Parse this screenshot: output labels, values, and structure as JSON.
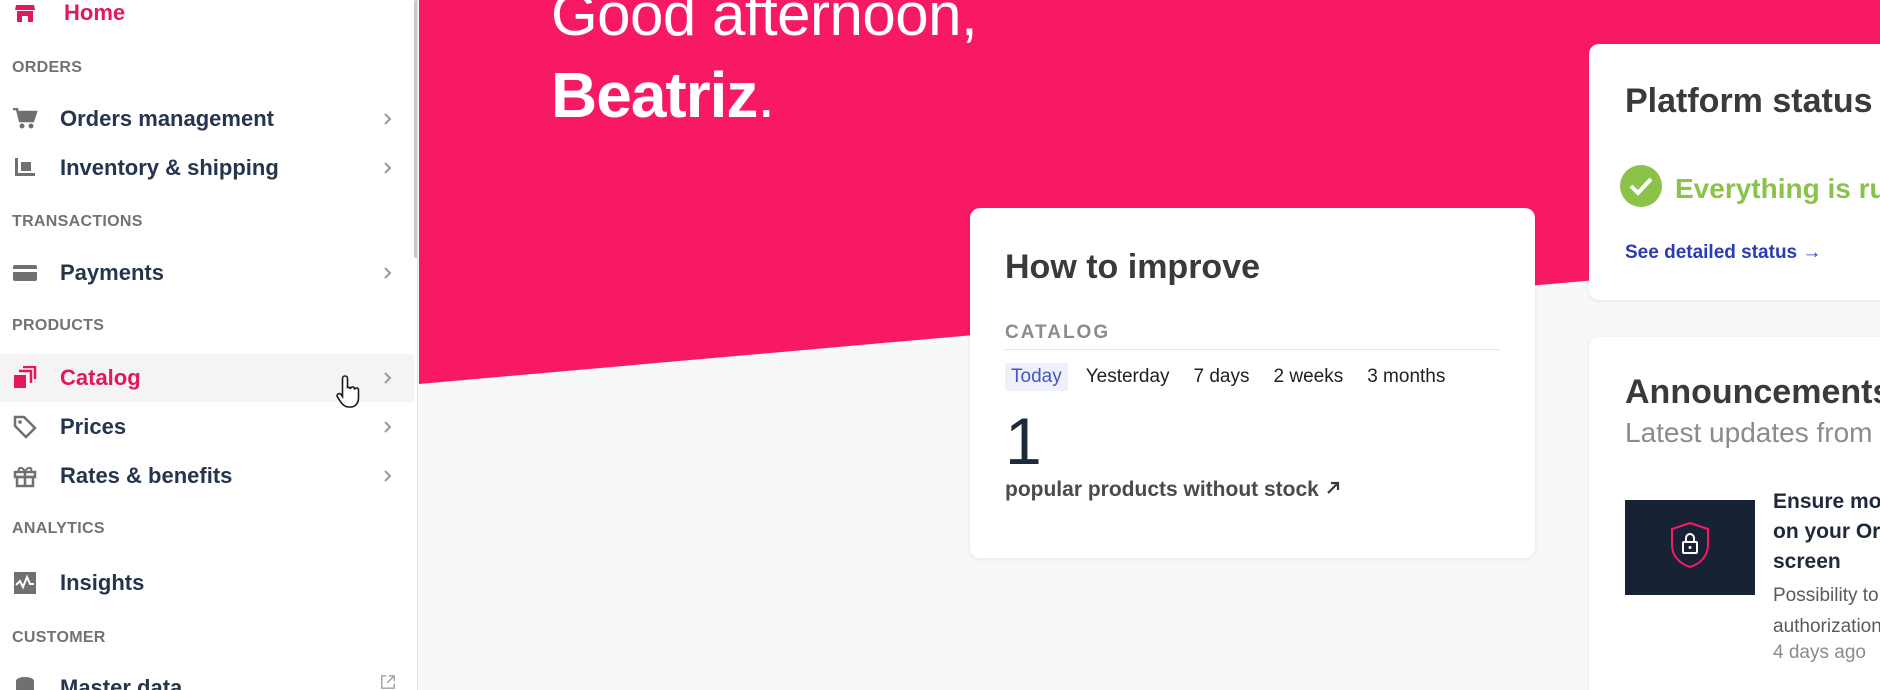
{
  "colors": {
    "brand": "#f71963",
    "status_ok": "#8bc34a",
    "link": "#2a3bb7"
  },
  "sidebar": {
    "home": {
      "label": "Home",
      "icon": "store-icon"
    },
    "sections": {
      "orders": "ORDERS",
      "transactions": "TRANSACTIONS",
      "products": "PRODUCTS",
      "analytics": "ANALYTICS",
      "customer": "CUSTOMER"
    },
    "items": {
      "orders_management": "Orders management",
      "inventory_shipping": "Inventory & shipping",
      "payments": "Payments",
      "catalog": "Catalog",
      "prices": "Prices",
      "rates_benefits": "Rates & benefits",
      "insights": "Insights",
      "master_data": "Master data"
    }
  },
  "greeting": {
    "line1": "Good afternoon,",
    "name": "Beatriz",
    "punct": "."
  },
  "improve": {
    "title": "How to improve",
    "section": "CATALOG",
    "tabs": [
      "Today",
      "Yesterday",
      "7 days",
      "2 weeks",
      "3 months"
    ],
    "selected_tab": "Today",
    "value": "1",
    "description": "popular products without stock"
  },
  "status": {
    "title": "Platform status",
    "message": "Everything is running correctly.",
    "link": "See detailed status →"
  },
  "announcements": {
    "title": "Announcements",
    "subtitle": "Latest updates from the Platform",
    "items": [
      {
        "title": "Ensure more safety and control on your Order Authorization screen",
        "description": "Possibility to limit user access to order authorizations",
        "time": "4 days ago"
      }
    ]
  }
}
